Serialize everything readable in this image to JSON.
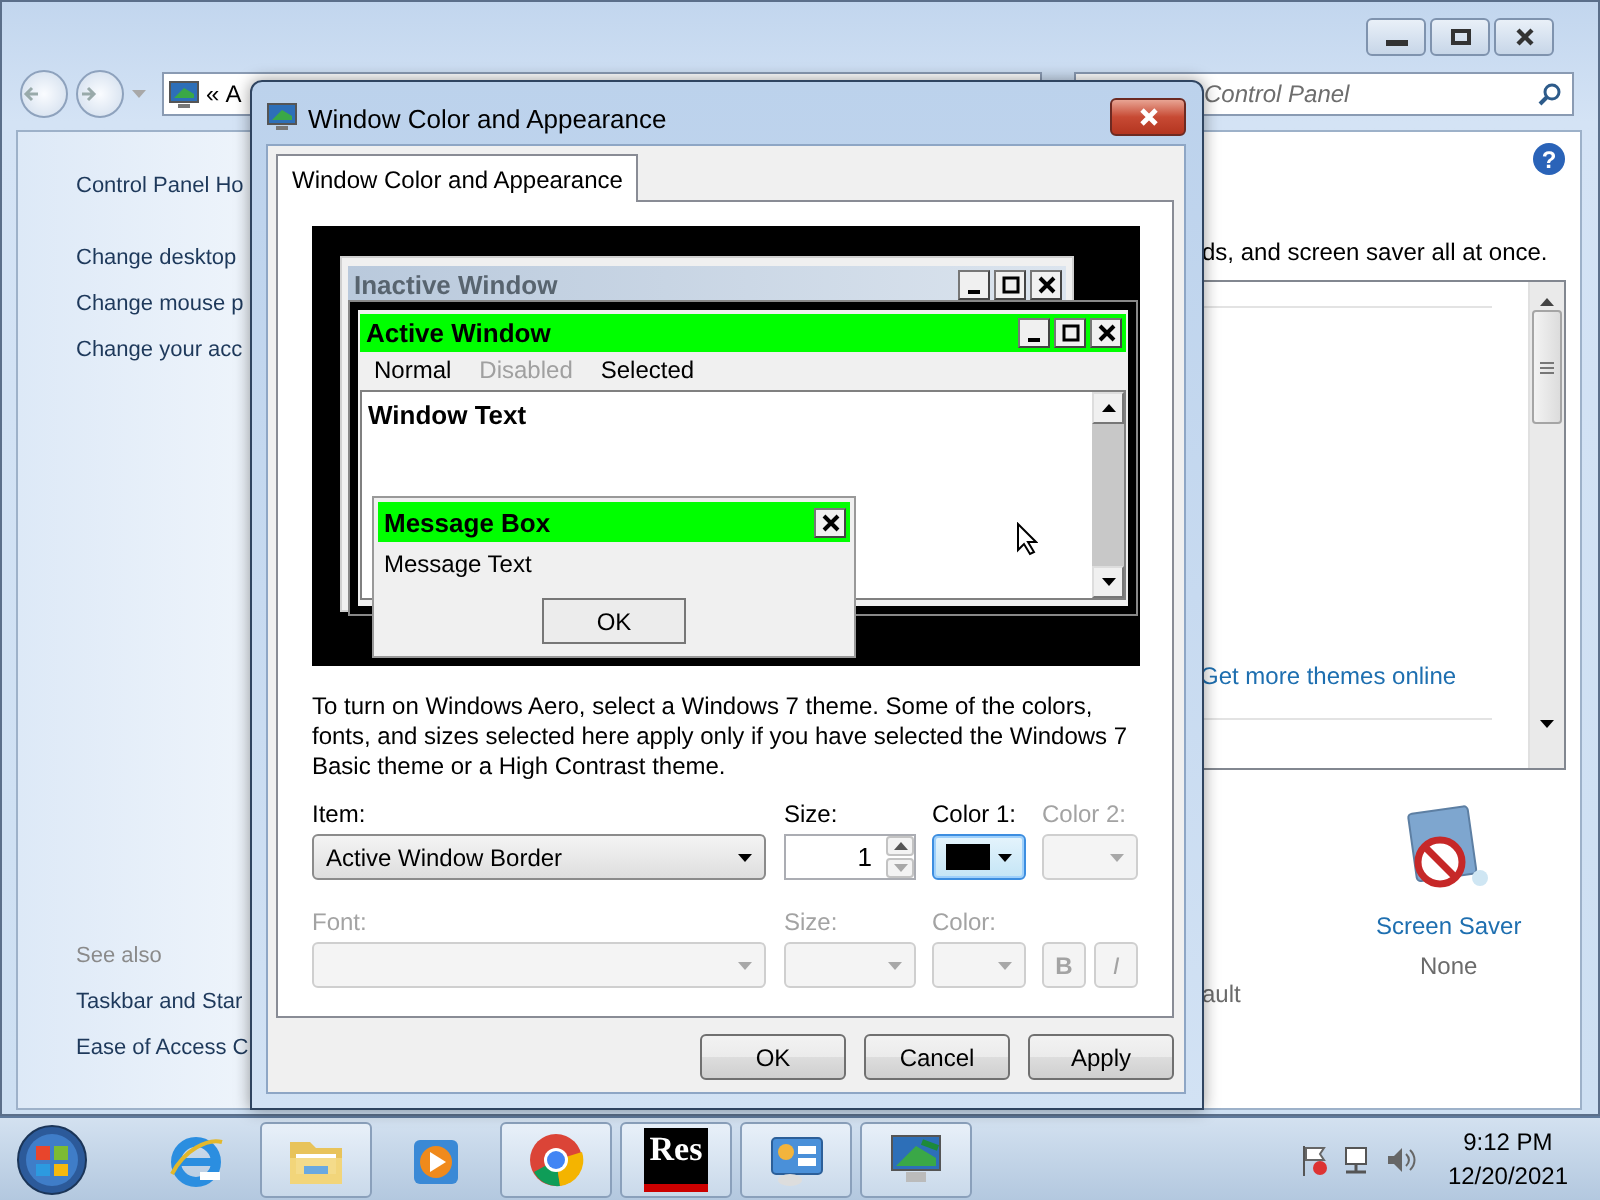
{
  "background_window": {
    "address_bar": {
      "chevron": "«",
      "text": "A"
    },
    "search": {
      "placeholder": "Control Panel"
    },
    "sidebar": {
      "home": "Control Panel Ho",
      "items": [
        "Change desktop",
        "Change mouse p",
        "Change your acc"
      ],
      "see_also_heading": "See also",
      "see_also": [
        "Taskbar and Star",
        "Ease of Access C"
      ]
    },
    "main": {
      "help_button": "?",
      "description": "ds, and screen saver all at once.",
      "themes_link": "Get more themes online",
      "desktop_caption": "ault",
      "screen_saver": {
        "label": "Screen Saver",
        "value": "None"
      }
    }
  },
  "dialog": {
    "title": "Window Color and Appearance",
    "tabs": [
      {
        "label": "Window Color and Appearance",
        "selected": true
      }
    ],
    "preview": {
      "inactive_title": "Inactive Window",
      "active_title": "Active Window",
      "menu": [
        {
          "label": "Normal",
          "kind": "normal"
        },
        {
          "label": "Disabled",
          "kind": "disabled"
        },
        {
          "label": "Selected",
          "kind": "selected"
        }
      ],
      "window_text": "Window Text",
      "message_box": {
        "title": "Message Box",
        "text": "Message Text",
        "button": "OK"
      }
    },
    "description": "To turn on Windows Aero, select a Windows 7 theme.  Some of the colors, fonts, and sizes selected here apply only if you have selected the Windows 7 Basic theme or a High Contrast theme.",
    "item": {
      "label": "Item:",
      "value": "Active Window Border",
      "disabled": false
    },
    "size": {
      "label": "Size:",
      "value": "1",
      "disabled": false
    },
    "color1": {
      "label": "Color 1:",
      "color": "#000000",
      "disabled": false
    },
    "color2": {
      "label": "Color 2:",
      "disabled": true
    },
    "font": {
      "label": "Font:",
      "disabled": true
    },
    "font_size": {
      "label": "Size:",
      "disabled": true
    },
    "font_color": {
      "label": "Color:",
      "disabled": true
    },
    "bold": {
      "label": "B",
      "disabled": true
    },
    "italic": {
      "label": "I",
      "disabled": true
    },
    "buttons": [
      "OK",
      "Cancel",
      "Apply"
    ]
  },
  "taskbar": {
    "items": [
      {
        "kind": "browser",
        "running": false
      },
      {
        "kind": "folder",
        "running": true
      },
      {
        "kind": "media",
        "running": false
      },
      {
        "kind": "chrome",
        "running": true
      },
      {
        "kind": "res",
        "label": "Res",
        "running": true
      },
      {
        "kind": "control-panel",
        "running": true
      },
      {
        "kind": "display",
        "running": true
      }
    ],
    "clock": {
      "time": "9:12 PM",
      "date": "12/20/2021"
    }
  }
}
